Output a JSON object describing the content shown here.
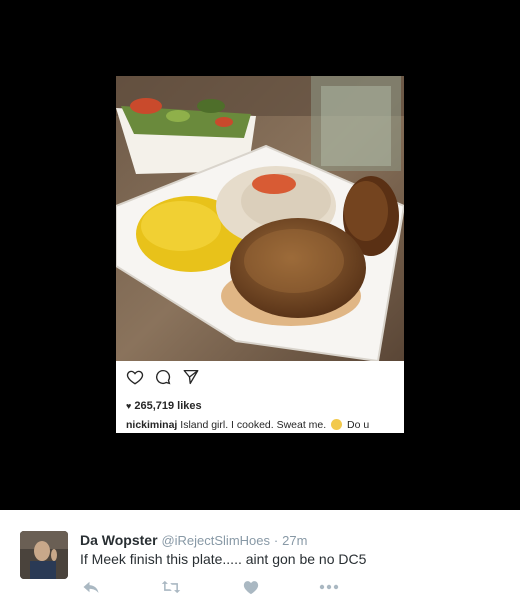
{
  "embedded_post": {
    "likes_count": "265,719 likes",
    "caption_user": "nickiminaj",
    "caption_text": "Island girl. I cooked. Sweat me.",
    "caption_trailing": "Do u",
    "icons": {
      "like": "heart-outline-icon",
      "comment": "comment-bubble-icon",
      "share": "paper-plane-icon",
      "likes_marker": "heart-icon"
    }
  },
  "tweet": {
    "display_name": "Da Wopster",
    "handle": "@iRejectSlimHoes",
    "separator": "·",
    "timestamp": "27m",
    "text": "If Meek finish this plate..... aint gon be no DC5",
    "actions": {
      "reply": "reply-icon",
      "retweet": "retweet-icon",
      "like": "heart-icon",
      "more": "more-dots-icon"
    }
  },
  "colors": {
    "media_background": "#000000",
    "action_icon": "#aab8c2",
    "name_text": "#292f33",
    "handle_text": "#8899a6",
    "insta_text": "#262626"
  }
}
